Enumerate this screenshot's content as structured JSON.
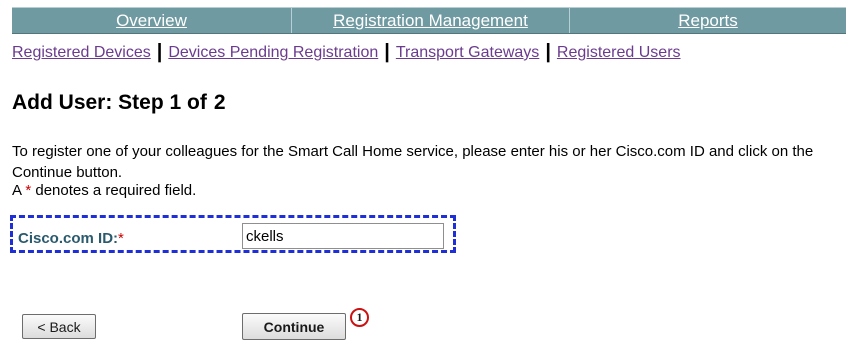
{
  "top_nav": {
    "tabs": [
      {
        "label": "Overview"
      },
      {
        "label": "Registration Management"
      },
      {
        "label": "Reports"
      }
    ]
  },
  "sub_nav": {
    "links": [
      {
        "label": "Registered Devices"
      },
      {
        "label": "Devices Pending Registration"
      },
      {
        "label": "Transport Gateways"
      },
      {
        "label": "Registered Users"
      }
    ],
    "separator": "|"
  },
  "page": {
    "title": "Add User: Step 1 of",
    "title_number": "2",
    "intro": "To register one of your colleagues for the Smart Call Home service, please enter his or her Cisco.com ID and click on the Continue button.",
    "required_note_prefix": "A",
    "required_star": "*",
    "required_note_suffix": "denotes a required field."
  },
  "form": {
    "cisco_id_label": "Cisco.com ID:",
    "cisco_id_required": "*",
    "cisco_id_value": "ckells"
  },
  "buttons": {
    "back": "< Back",
    "continue": "Continue"
  },
  "annotation": {
    "step_marker": "1"
  },
  "colors": {
    "nav_background": "#6f9aa1",
    "nav_text": "#ffffff",
    "link": "#6b3b8e",
    "required": "#cc0000",
    "label": "#2a5a6d",
    "highlight_border": "#1f2fd7",
    "marker_border": "#cc1111"
  }
}
